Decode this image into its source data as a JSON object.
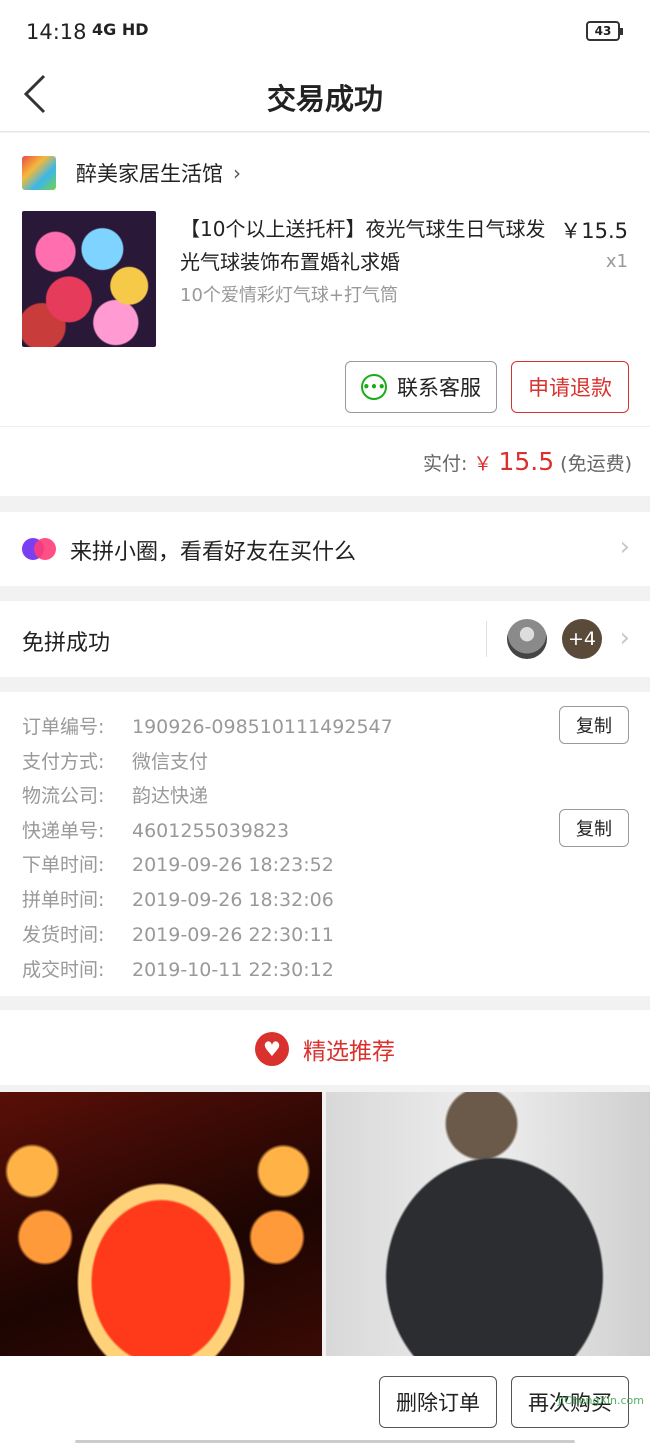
{
  "status": {
    "time": "14:18",
    "network": "4G HD",
    "battery": "43"
  },
  "nav": {
    "title": "交易成功"
  },
  "shop": {
    "name": "醉美家居生活馆"
  },
  "product": {
    "title": "【10个以上送托杆】夜光气球生日气球发光气球装饰布置婚礼求婚",
    "price": "￥15.5",
    "qty": "x1",
    "spec": "10个爱情彩灯气球+打气筒"
  },
  "actions": {
    "contact_label": "联系客服",
    "refund_label": "申请退款"
  },
  "payment": {
    "label": "实付:",
    "currency": "￥",
    "amount": "15.5",
    "shipping": "(免运费)"
  },
  "circle": {
    "text": "来拼小圈，看看好友在买什么"
  },
  "group": {
    "text": "免拼成功",
    "more": "+4"
  },
  "order_info": [
    {
      "label": "订单编号:",
      "value": "190926-098510111492547"
    },
    {
      "label": "支付方式:",
      "value": "微信支付"
    },
    {
      "label": "物流公司:",
      "value": "韵达快递"
    },
    {
      "label": "快递单号:",
      "value": "4601255039823"
    },
    {
      "label": "下单时间:",
      "value": "2019-09-26 18:23:52"
    },
    {
      "label": "拼单时间:",
      "value": "2019-09-26 18:32:06"
    },
    {
      "label": "发货时间:",
      "value": "2019-09-26 22:30:11"
    },
    {
      "label": "成交时间:",
      "value": "2019-10-11 22:30:12"
    }
  ],
  "copy_label": "复制",
  "recommend": {
    "title": "精选推荐"
  },
  "bottom": {
    "delete_label": "删除订单",
    "rebuy_label": "再次购买",
    "watermark": "JiChengXin.com"
  },
  "colors": {
    "accent": "#d9322e",
    "wechat": "#1aad19"
  }
}
